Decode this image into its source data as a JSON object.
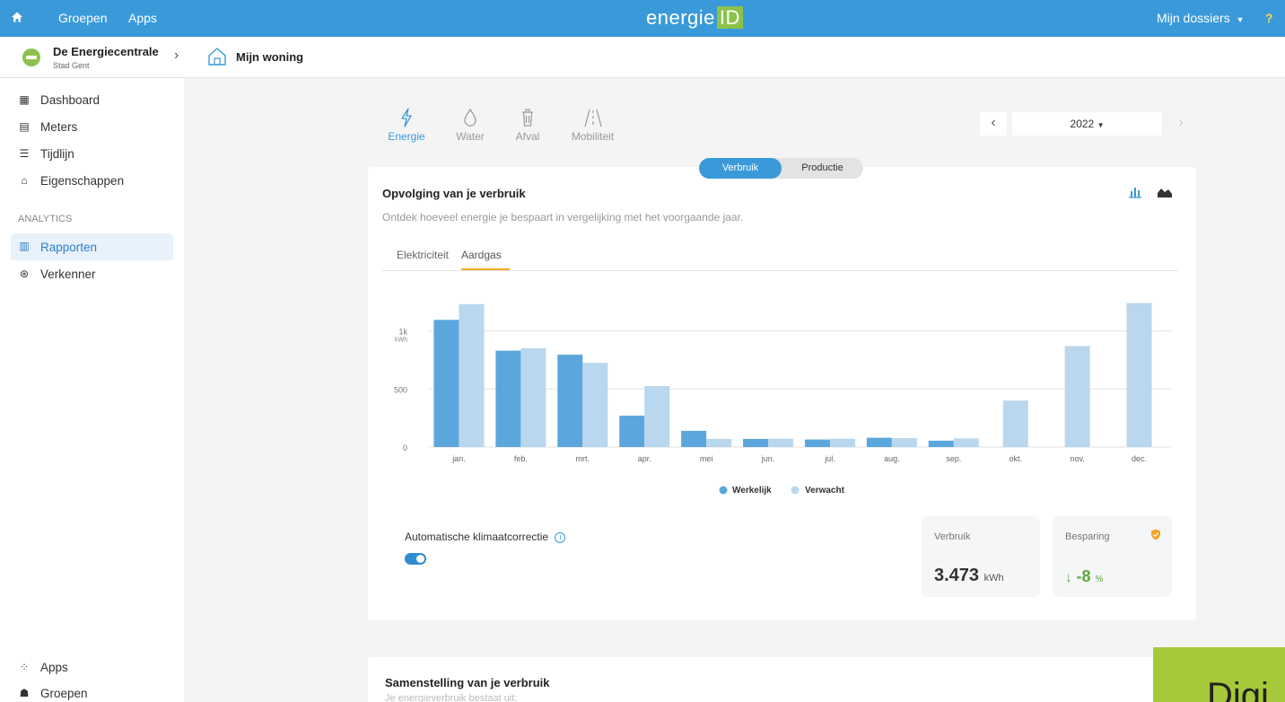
{
  "topbar": {
    "groepen": "Groepen",
    "apps": "Apps",
    "logo_main": "energie",
    "logo_id": "ID",
    "mijn_dossiers": "Mijn dossiers",
    "help": "?"
  },
  "crumb": {
    "org_name": "De Energiecentrale",
    "org_sub": "Stad Gent",
    "home": "Mijn woning"
  },
  "sidebar": {
    "items": [
      {
        "label": "Dashboard",
        "icon": "dashboard-icon"
      },
      {
        "label": "Meters",
        "icon": "meter-icon"
      },
      {
        "label": "Tijdlijn",
        "icon": "timeline-icon"
      },
      {
        "label": "Eigenschappen",
        "icon": "house-icon"
      }
    ],
    "section": "ANALYTICS",
    "analytics": [
      {
        "label": "Rapporten",
        "icon": "bar-chart-icon"
      },
      {
        "label": "Verkenner",
        "icon": "explorer-icon"
      }
    ],
    "bottom": [
      {
        "label": "Apps",
        "icon": "apps-icon"
      },
      {
        "label": "Groepen",
        "icon": "group-icon"
      }
    ]
  },
  "categories": [
    {
      "label": "Energie",
      "icon": "lightning-icon"
    },
    {
      "label": "Water",
      "icon": "water-drop-icon"
    },
    {
      "label": "Afval",
      "icon": "trash-icon"
    },
    {
      "label": "Mobiliteit",
      "icon": "road-icon"
    }
  ],
  "year": {
    "value": "2022"
  },
  "toggle": {
    "verbruik": "Verbruik",
    "productie": "Productie"
  },
  "report": {
    "title": "Opvolging van je verbruik",
    "subtitle": "Ontdek hoeveel energie je bespaart in vergelijking met het voorgaande jaar.",
    "tabs": [
      "Elektriciteit",
      "Aardgas"
    ],
    "active_tab": "Aardgas"
  },
  "klimaat": {
    "label": "Automatische klimaatcorrectie",
    "enabled": true
  },
  "stats": {
    "verbruik_label": "Verbruik",
    "verbruik_value": "3.473",
    "verbruik_unit": "kWh",
    "besparing_label": "Besparing",
    "besparing_arrow": "↓",
    "besparing_value": "-8",
    "besparing_unit": "%"
  },
  "card2": {
    "title": "Samenstelling van je verbruik",
    "subtitle": "Je energieverbruik bestaat uit:"
  },
  "banner": {
    "text": "Digi"
  },
  "colors": {
    "accent": "#3a9ad9",
    "actual": "#5ba6dc",
    "expected": "#b9d7ee",
    "green": "#5fa83a",
    "orange": "#f5a623"
  },
  "chart_data": {
    "type": "bar",
    "categories": [
      "jan.",
      "feb.",
      "mrt.",
      "apr.",
      "mei",
      "jun.",
      "jul.",
      "aug.",
      "sep.",
      "okt.",
      "nov.",
      "dec."
    ],
    "series": [
      {
        "name": "Werkelijk",
        "values": [
          1095,
          830,
          795,
          270,
          140,
          70,
          65,
          80,
          55,
          null,
          null,
          null
        ]
      },
      {
        "name": "Verwacht",
        "values": [
          1230,
          850,
          725,
          525,
          70,
          72,
          72,
          77,
          75,
          400,
          870,
          1240
        ]
      }
    ],
    "yticks": [
      "0",
      "500",
      "1k"
    ],
    "yunit": "kWh",
    "ylim": [
      0,
      1300
    ],
    "legend_position": "bottom"
  }
}
